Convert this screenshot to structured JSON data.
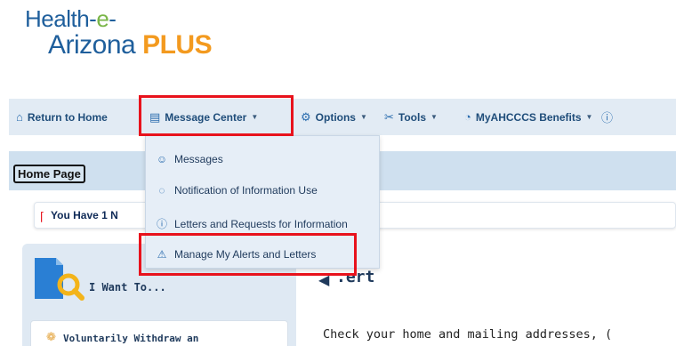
{
  "logo": {
    "line1_a": "Health-",
    "line1_b": "e",
    "line1_c": "-",
    "line2_a": "Arizona ",
    "line2_b": "PLUS"
  },
  "nav": {
    "return_home": "Return to Home",
    "message_center": "Message Center",
    "options": "Options",
    "tools": "Tools",
    "myahcccs": "MyAHCCCS Benefits"
  },
  "dropdown": {
    "items": [
      {
        "label": "Messages",
        "icon": "messages-icon"
      },
      {
        "label": "Notification of Information Use",
        "icon": "speech-bubble-icon"
      },
      {
        "label": "Letters and Requests for Information",
        "icon": "info-circle-icon"
      },
      {
        "label": "Manage My Alerts and Letters",
        "icon": "warning-triangle-icon"
      }
    ]
  },
  "homepage": {
    "label": "Home Page"
  },
  "alert_strip": {
    "text": "You Have 1 N"
  },
  "sidepanel": {
    "title": "I Want To...",
    "card": "Voluntarily Withdraw an"
  },
  "main": {
    "title": ".ert",
    "body": "Check your home and mailing addresses, ("
  },
  "colors": {
    "accent": "#1f5f9c",
    "highlight": "#e8121c",
    "plus": "#f39a1f",
    "nav_bg": "#e2ebf4"
  }
}
